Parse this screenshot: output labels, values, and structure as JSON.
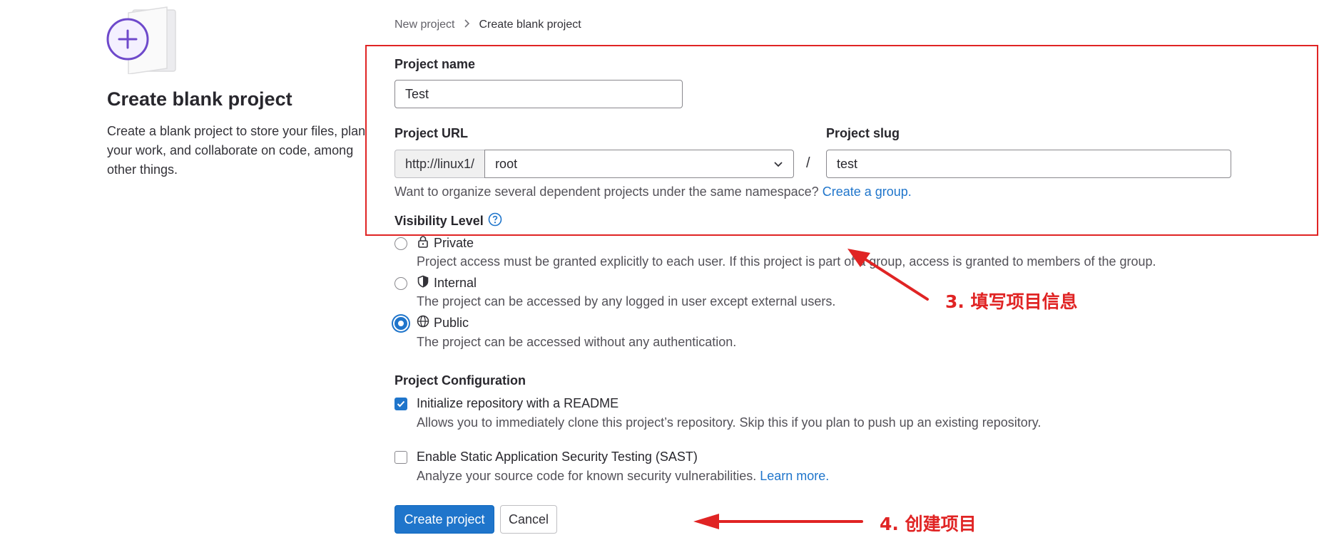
{
  "breadcrumb": {
    "parent": "New project",
    "current": "Create blank project"
  },
  "left": {
    "title": "Create blank project",
    "description": "Create a blank project to store your files, plan your work, and collaborate on code, among other things."
  },
  "form": {
    "project_name_label": "Project name",
    "project_name_value": "Test",
    "project_url_label": "Project URL",
    "url_prefix": "http://linux1/",
    "namespace_value": "root",
    "slash": "/",
    "project_slug_label": "Project slug",
    "project_slug_value": "test",
    "namespace_help": "Want to organize several dependent projects under the same namespace?",
    "create_group_link": "Create a group.",
    "visibility_label": "Visibility Level",
    "visibility_options": [
      {
        "label": "Private",
        "help": "Project access must be granted explicitly to each user. If this project is part of a group, access is granted to members of the group.",
        "icon": "lock-icon",
        "selected": false
      },
      {
        "label": "Internal",
        "help": "The project can be accessed by any logged in user except external users.",
        "icon": "shield-icon",
        "selected": false
      },
      {
        "label": "Public",
        "help": "The project can be accessed without any authentication.",
        "icon": "globe-icon",
        "selected": true
      }
    ],
    "config_label": "Project Configuration",
    "readme": {
      "label": "Initialize repository with a README",
      "help": "Allows you to immediately clone this project’s repository. Skip this if you plan to push up an existing repository.",
      "checked": true
    },
    "sast": {
      "label": "Enable Static Application Security Testing (SAST)",
      "help": "Analyze your source code for known security vulnerabilities.",
      "learn_more": "Learn more.",
      "checked": false
    },
    "create_button": "Create project",
    "cancel_button": "Cancel"
  },
  "annotations": {
    "step3": "3. 填写项目信息",
    "step4": "4. 创建项目"
  },
  "colors": {
    "accent": "#1f75cb",
    "annotation": "#e02424",
    "illustration": "#6e49cb"
  }
}
